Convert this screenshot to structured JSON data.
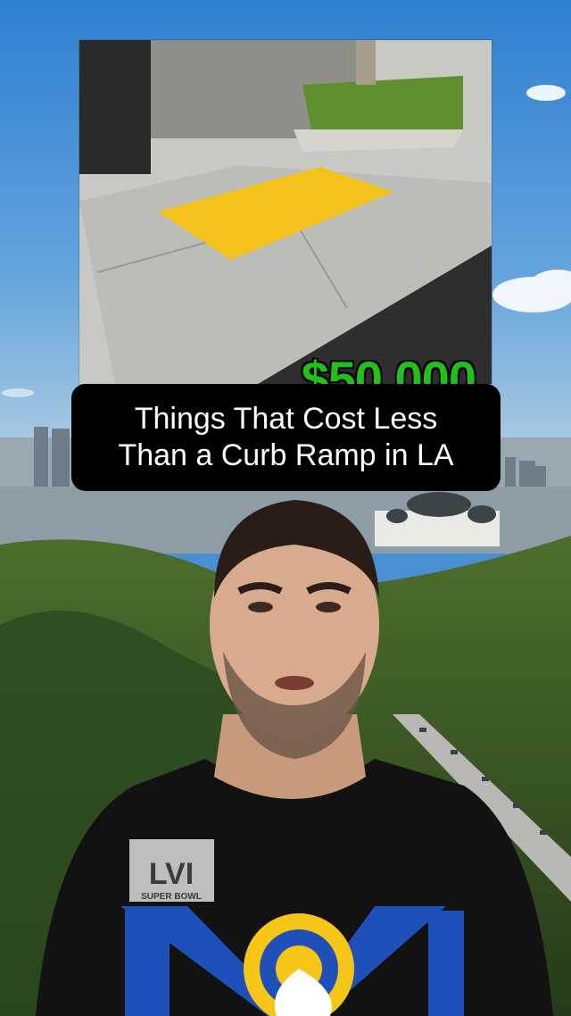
{
  "overlay": {
    "price": "$50,000",
    "caption_lines": [
      "Things That Cost Less",
      "Than a Curb Ramp in LA"
    ]
  },
  "shirt": {
    "logo_numeral": "LVI",
    "logo_subtext": "SUPER BOWL"
  },
  "colors": {
    "price_green": "#22c01c",
    "tactile_yellow": "#f4c21a",
    "caption_bg": "#000000",
    "caption_text": "#ffffff",
    "rams_blue": "#1f4fb8",
    "rams_gold": "#f5c518"
  }
}
